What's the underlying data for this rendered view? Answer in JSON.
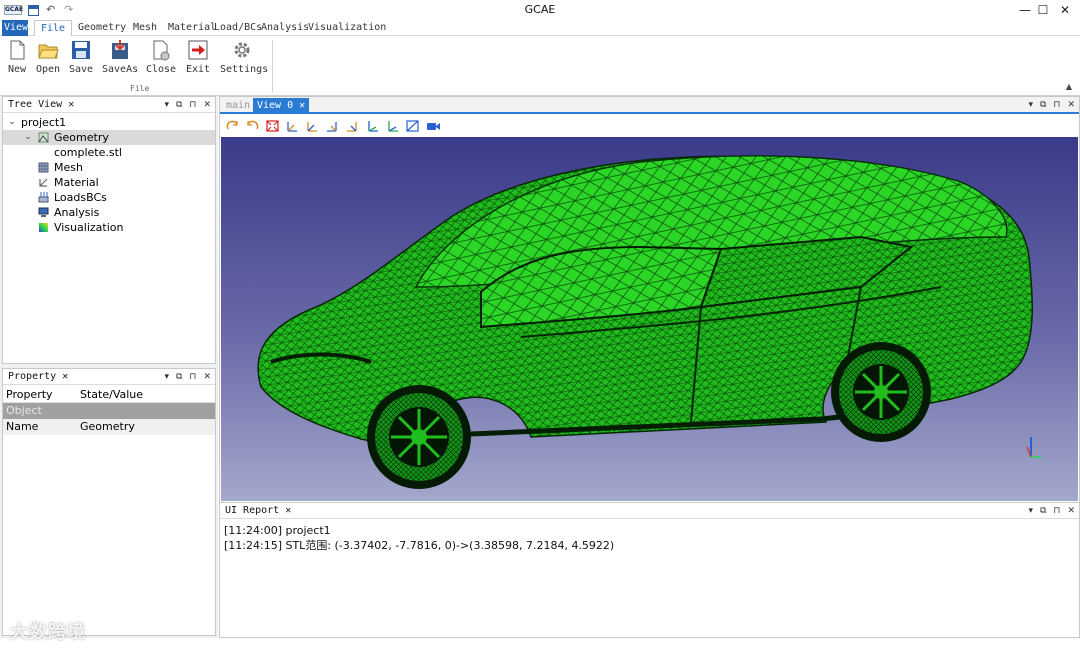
{
  "window": {
    "title": "GCAE"
  },
  "quick_access": [
    "GCAE-logo-icon",
    "save-icon",
    "undo-icon",
    "redo-icon"
  ],
  "window_buttons": {
    "minimize": "—",
    "maximize": "☐",
    "close": "✕"
  },
  "menu": {
    "tabs": [
      "View",
      "File",
      "Geometry",
      "Mesh",
      "Material",
      "Load/BCs",
      "Analysis",
      "Visualization"
    ],
    "active": "File"
  },
  "ribbon": {
    "buttons": [
      {
        "label": "New",
        "icon": "new-document-icon"
      },
      {
        "label": "Open",
        "icon": "open-folder-icon"
      },
      {
        "label": "Save",
        "icon": "save-icon"
      },
      {
        "label": "SaveAs",
        "icon": "save-as-icon"
      },
      {
        "label": "Close",
        "icon": "close-document-icon"
      },
      {
        "label": "Exit",
        "icon": "exit-icon"
      },
      {
        "label": "Settings",
        "icon": "gear-icon"
      }
    ],
    "group_label": "File",
    "collapse": "▲"
  },
  "tree_view": {
    "title": "Tree View",
    "items": [
      {
        "label": "project1",
        "level": 0,
        "expander": "⌄",
        "icon": ""
      },
      {
        "label": "Geometry",
        "level": 1,
        "expander": "⌄",
        "icon": "geometry-icon",
        "selected": true
      },
      {
        "label": "complete.stl",
        "level": 2,
        "expander": "",
        "icon": ""
      },
      {
        "label": "Mesh",
        "level": 1,
        "expander": "",
        "icon": "mesh-icon"
      },
      {
        "label": "Material",
        "level": 1,
        "expander": "",
        "icon": "material-icon"
      },
      {
        "label": "LoadsBCs",
        "level": 1,
        "expander": "",
        "icon": "loads-icon"
      },
      {
        "label": "Analysis",
        "level": 1,
        "expander": "",
        "icon": "analysis-icon"
      },
      {
        "label": "Visualization",
        "level": 1,
        "expander": "",
        "icon": "visualization-icon"
      }
    ]
  },
  "property": {
    "title": "Property",
    "headers": [
      "Property",
      "State/Value"
    ],
    "group": "Object",
    "rows": [
      {
        "name": "Name",
        "value": "Geometry"
      }
    ]
  },
  "panel_controls": {
    "dropdown": "▾",
    "float": "⧉",
    "pin": "⊓",
    "close": "✕"
  },
  "view": {
    "tabs": [
      "main",
      "View 0"
    ],
    "active_tab": "View 0",
    "toolbar_icons": [
      "rotate-view-icon",
      "rotate-view-2-icon",
      "fit-all-icon",
      "view-front-icon",
      "view-back-icon",
      "view-left-icon",
      "view-right-icon",
      "view-top-icon",
      "view-bottom-icon",
      "view-iso-icon",
      "camera-icon"
    ],
    "mesh_color": "#22c81e",
    "background_top": "#3a3a8a",
    "background_bottom": "#a4a8cc"
  },
  "report": {
    "title": "UI Report",
    "lines": [
      "[11:24:00] project1",
      "[11:24:15] STL范围: (-3.37402, -7.7816, 0)->(3.38598, 7.2184, 4.5922)"
    ]
  },
  "watermark": "大数跨境"
}
